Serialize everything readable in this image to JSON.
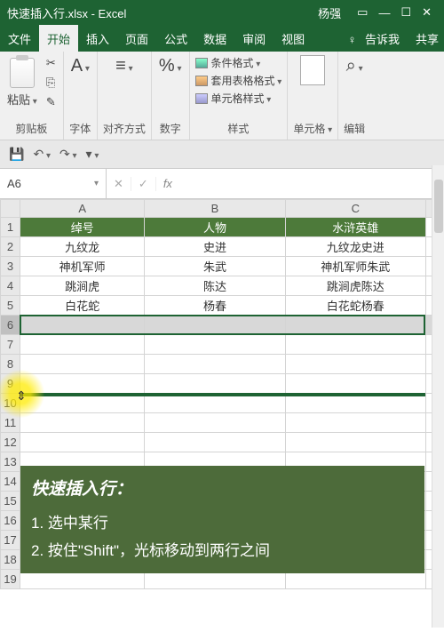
{
  "titlebar": {
    "filename": "快速插入行.xlsx - Excel",
    "user": "杨强"
  },
  "tabs": {
    "file": "文件",
    "home": "开始",
    "insert": "插入",
    "layout": "页面",
    "formulas": "公式",
    "data": "数据",
    "review": "审阅",
    "view": "视图",
    "tellme": "告诉我",
    "share": "共享"
  },
  "ribbon": {
    "paste": "粘贴",
    "clipboard": "剪贴板",
    "font": "字体",
    "align": "对齐方式",
    "number": "数字",
    "cond_format": "条件格式",
    "table_format": "套用表格格式",
    "cell_style": "单元格样式",
    "styles": "样式",
    "cells": "单元格",
    "editing": "编辑"
  },
  "namebox": "A6",
  "fx": "fx",
  "columns": [
    "A",
    "B",
    "C"
  ],
  "headers": {
    "c1": "绰号",
    "c2": "人物",
    "c3": "水浒英雄"
  },
  "rows": [
    {
      "c1": "九纹龙",
      "c2": "史进",
      "c3": "九纹龙史进"
    },
    {
      "c1": "神机军师",
      "c2": "朱武",
      "c3": "神机军师朱武"
    },
    {
      "c1": "跳涧虎",
      "c2": "陈达",
      "c3": "跳涧虎陈达"
    },
    {
      "c1": "白花蛇",
      "c2": "杨春",
      "c3": "白花蛇杨春"
    }
  ],
  "guide": {
    "title": "快速插入行：",
    "step1": "1. 选中某行",
    "step2": "2. 按住\"Shift\"，光标移动到两行之间"
  },
  "chart_data": {
    "type": "table",
    "title": "快速插入行",
    "columns": [
      "绰号",
      "人物",
      "水浒英雄"
    ],
    "rows": [
      [
        "九纹龙",
        "史进",
        "九纹龙史进"
      ],
      [
        "神机军师",
        "朱武",
        "神机军师朱武"
      ],
      [
        "跳涧虎",
        "陈达",
        "跳涧虎陈达"
      ],
      [
        "白花蛇",
        "杨春",
        "白花蛇杨春"
      ]
    ]
  }
}
